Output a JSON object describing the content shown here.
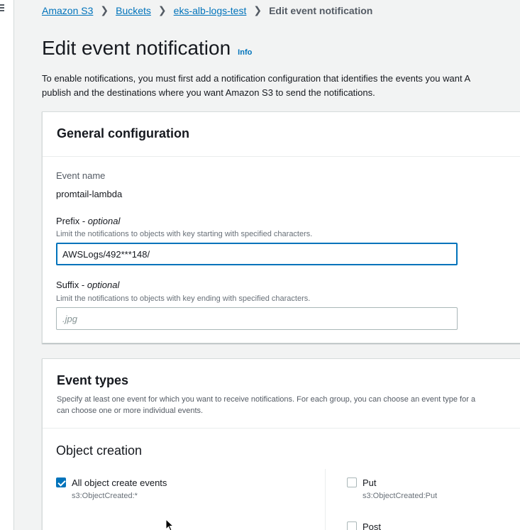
{
  "breadcrumb": {
    "items": [
      "Amazon S3",
      "Buckets",
      "eks-alb-logs-test"
    ],
    "current": "Edit event notification"
  },
  "page": {
    "title": "Edit event notification",
    "info": "Info",
    "description_line1": "To enable notifications, you must first add a notification configuration that identifies the events you want A",
    "description_line2": "publish and the destinations where you want Amazon S3 to send the notifications."
  },
  "general": {
    "title": "General configuration",
    "event_name_label": "Event name",
    "event_name_value": "promtail-lambda",
    "prefix_label": "Prefix - ",
    "prefix_optional": "optional",
    "prefix_hint": "Limit the notifications to objects with key starting with specified characters.",
    "prefix_value": "AWSLogs/492***148/",
    "suffix_label": "Suffix - ",
    "suffix_optional": "optional",
    "suffix_hint": "Limit the notifications to objects with key ending with specified characters.",
    "suffix_placeholder": ".jpg"
  },
  "event_types": {
    "title": "Event types",
    "desc_line1": "Specify at least one event for which you want to receive notifications. For each group, you can choose an event type for a",
    "desc_line2": "can choose one or more individual events.",
    "section_title": "Object creation",
    "options": [
      {
        "label": "All object create events",
        "sub": "s3:ObjectCreated:*",
        "checked": true
      },
      {
        "label": "Put",
        "sub": "s3:ObjectCreated:Put",
        "checked": false
      },
      {
        "label": "Post",
        "sub": "",
        "checked": false
      }
    ]
  },
  "colors": {
    "link": "#0073bb",
    "accent": "#0073bb",
    "background": "#f2f3f3"
  }
}
